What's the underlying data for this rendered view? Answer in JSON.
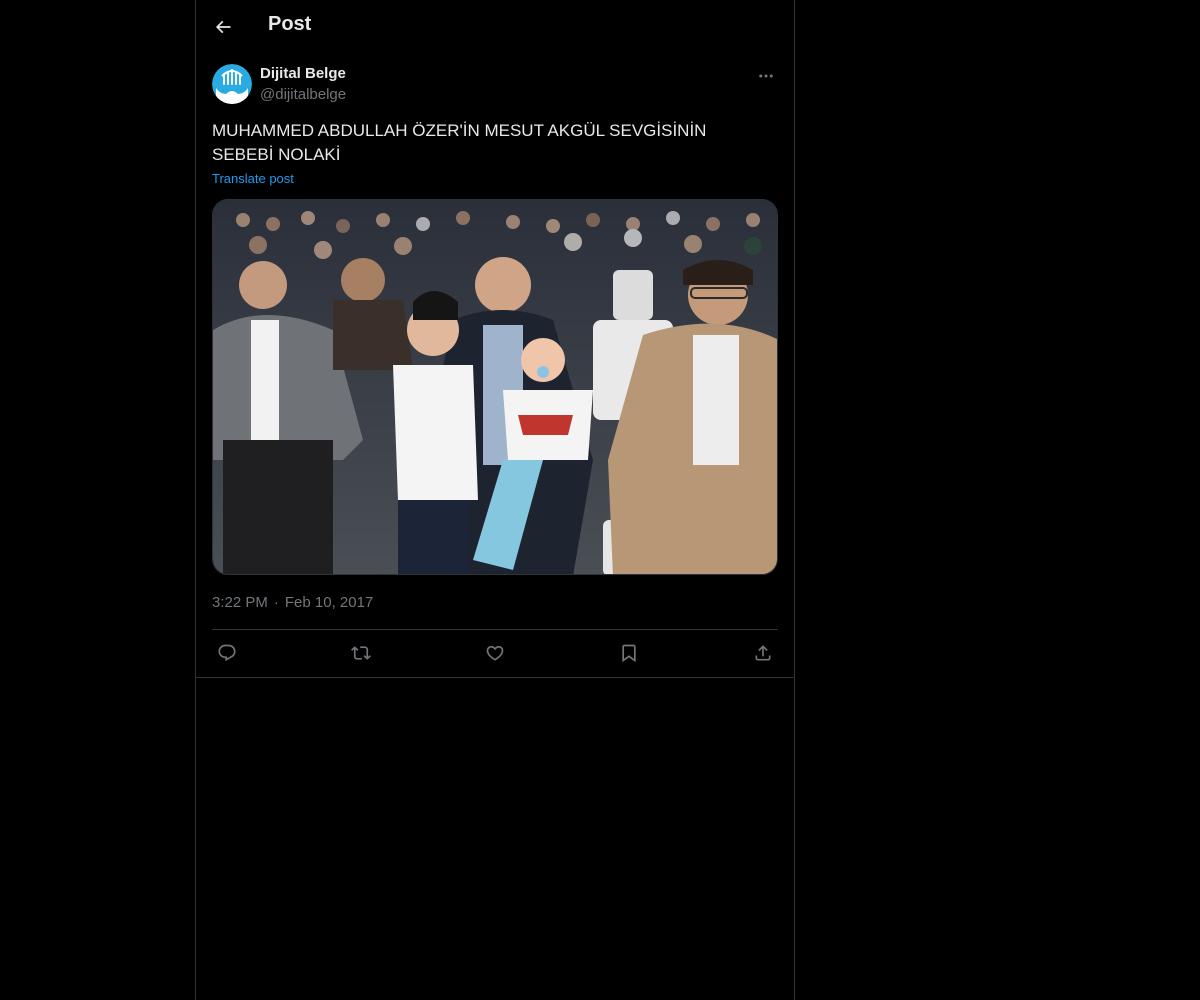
{
  "header": {
    "back_icon": "arrow-left-icon",
    "title": "Post"
  },
  "post": {
    "author": {
      "display_name": "Dijital Belge",
      "handle": "@dijitalbelge",
      "avatar_icon": "dijital-belge-logo",
      "avatar_color": "#29abe2"
    },
    "text": "MUHAMMED ABDULLAH ÖZER'İN MESUT AKGÜL SEVGİSİNİN SEBEBİ NOLAKİ",
    "translate_label": "Translate post",
    "time": "3:22 PM",
    "separator": "·",
    "date": "Feb 10, 2017"
  },
  "actions": [
    {
      "name": "reply",
      "icon": "reply-icon"
    },
    {
      "name": "repost",
      "icon": "repost-icon"
    },
    {
      "name": "like",
      "icon": "heart-icon"
    },
    {
      "name": "bookmark",
      "icon": "bookmark-icon"
    },
    {
      "name": "share",
      "icon": "share-icon"
    }
  ],
  "colors": {
    "background": "#000000",
    "text": "#e7e9ea",
    "secondary_text": "#71767b",
    "link": "#1d9bf0",
    "border": "#2f3336"
  }
}
